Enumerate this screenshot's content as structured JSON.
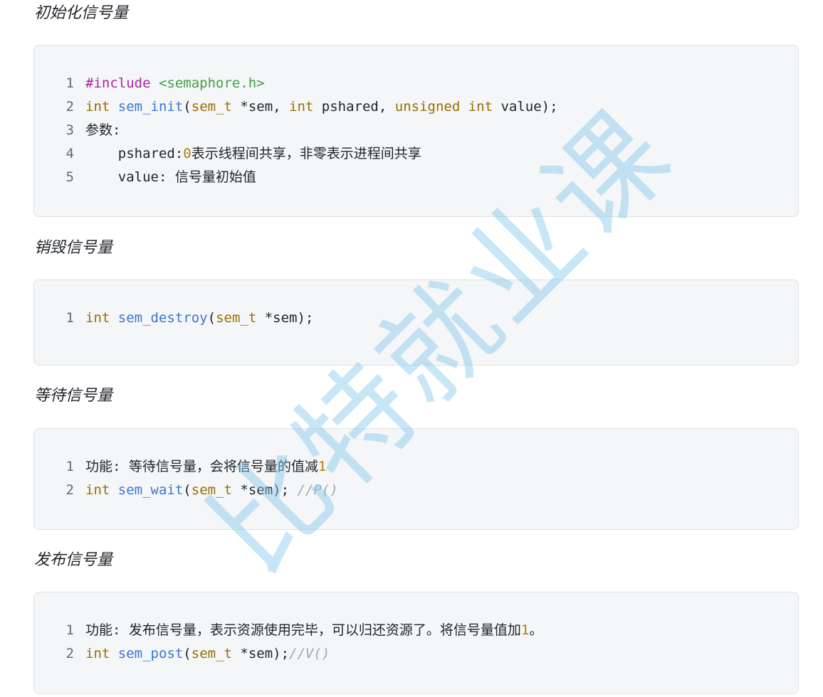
{
  "watermark": "比特就业课",
  "sections": [
    {
      "heading": "初始化信号量",
      "lines": [
        {
          "num": "1",
          "tokens": [
            {
              "t": "#include",
              "c": "pp"
            },
            {
              "t": " ",
              "c": "plain"
            },
            {
              "t": "<semaphore.h>",
              "c": "str"
            }
          ]
        },
        {
          "num": "2",
          "tokens": [
            {
              "t": "int",
              "c": "kw"
            },
            {
              "t": " ",
              "c": "plain"
            },
            {
              "t": "sem_init",
              "c": "fn"
            },
            {
              "t": "(",
              "c": "plain"
            },
            {
              "t": "sem_t",
              "c": "kw"
            },
            {
              "t": " *sem, ",
              "c": "plain"
            },
            {
              "t": "int",
              "c": "kw"
            },
            {
              "t": " pshared, ",
              "c": "plain"
            },
            {
              "t": "unsigned",
              "c": "kw"
            },
            {
              "t": " ",
              "c": "plain"
            },
            {
              "t": "int",
              "c": "kw"
            },
            {
              "t": " value);",
              "c": "plain"
            }
          ]
        },
        {
          "num": "3",
          "tokens": [
            {
              "t": "参数:",
              "c": "plain"
            }
          ]
        },
        {
          "num": "4",
          "tokens": [
            {
              "t": "    pshared:",
              "c": "plain"
            },
            {
              "t": "0",
              "c": "num"
            },
            {
              "t": "表示线程间共享，非零表示进程间共享",
              "c": "plain"
            }
          ]
        },
        {
          "num": "5",
          "tokens": [
            {
              "t": "    value: 信号量初始值",
              "c": "plain"
            }
          ]
        }
      ]
    },
    {
      "heading": "销毁信号量",
      "lines": [
        {
          "num": "1",
          "tokens": [
            {
              "t": "int",
              "c": "kw"
            },
            {
              "t": " ",
              "c": "plain"
            },
            {
              "t": "sem_destroy",
              "c": "fn"
            },
            {
              "t": "(",
              "c": "plain"
            },
            {
              "t": "sem_t",
              "c": "kw"
            },
            {
              "t": " *sem);",
              "c": "plain"
            }
          ]
        }
      ]
    },
    {
      "heading": "等待信号量",
      "lines": [
        {
          "num": "1",
          "tokens": [
            {
              "t": "功能: 等待信号量，会将信号量的值减",
              "c": "plain"
            },
            {
              "t": "1",
              "c": "num"
            }
          ]
        },
        {
          "num": "2",
          "tokens": [
            {
              "t": "int",
              "c": "kw"
            },
            {
              "t": " ",
              "c": "plain"
            },
            {
              "t": "sem_wait",
              "c": "fn"
            },
            {
              "t": "(",
              "c": "plain"
            },
            {
              "t": "sem_t",
              "c": "kw"
            },
            {
              "t": " *sem); ",
              "c": "plain"
            },
            {
              "t": "//P()",
              "c": "cm"
            }
          ]
        }
      ]
    },
    {
      "heading": "发布信号量",
      "lines": [
        {
          "num": "1",
          "tokens": [
            {
              "t": "功能: 发布信号量，表示资源使用完毕，可以归还资源了。将信号量值加",
              "c": "plain"
            },
            {
              "t": "1",
              "c": "num"
            },
            {
              "t": "。",
              "c": "plain"
            }
          ]
        },
        {
          "num": "2",
          "tokens": [
            {
              "t": "int",
              "c": "kw"
            },
            {
              "t": " ",
              "c": "plain"
            },
            {
              "t": "sem_post",
              "c": "fn"
            },
            {
              "t": "(",
              "c": "plain"
            },
            {
              "t": "sem_t",
              "c": "kw"
            },
            {
              "t": " *sem);",
              "c": "plain"
            },
            {
              "t": "//V()",
              "c": "cm"
            }
          ]
        }
      ]
    }
  ]
}
